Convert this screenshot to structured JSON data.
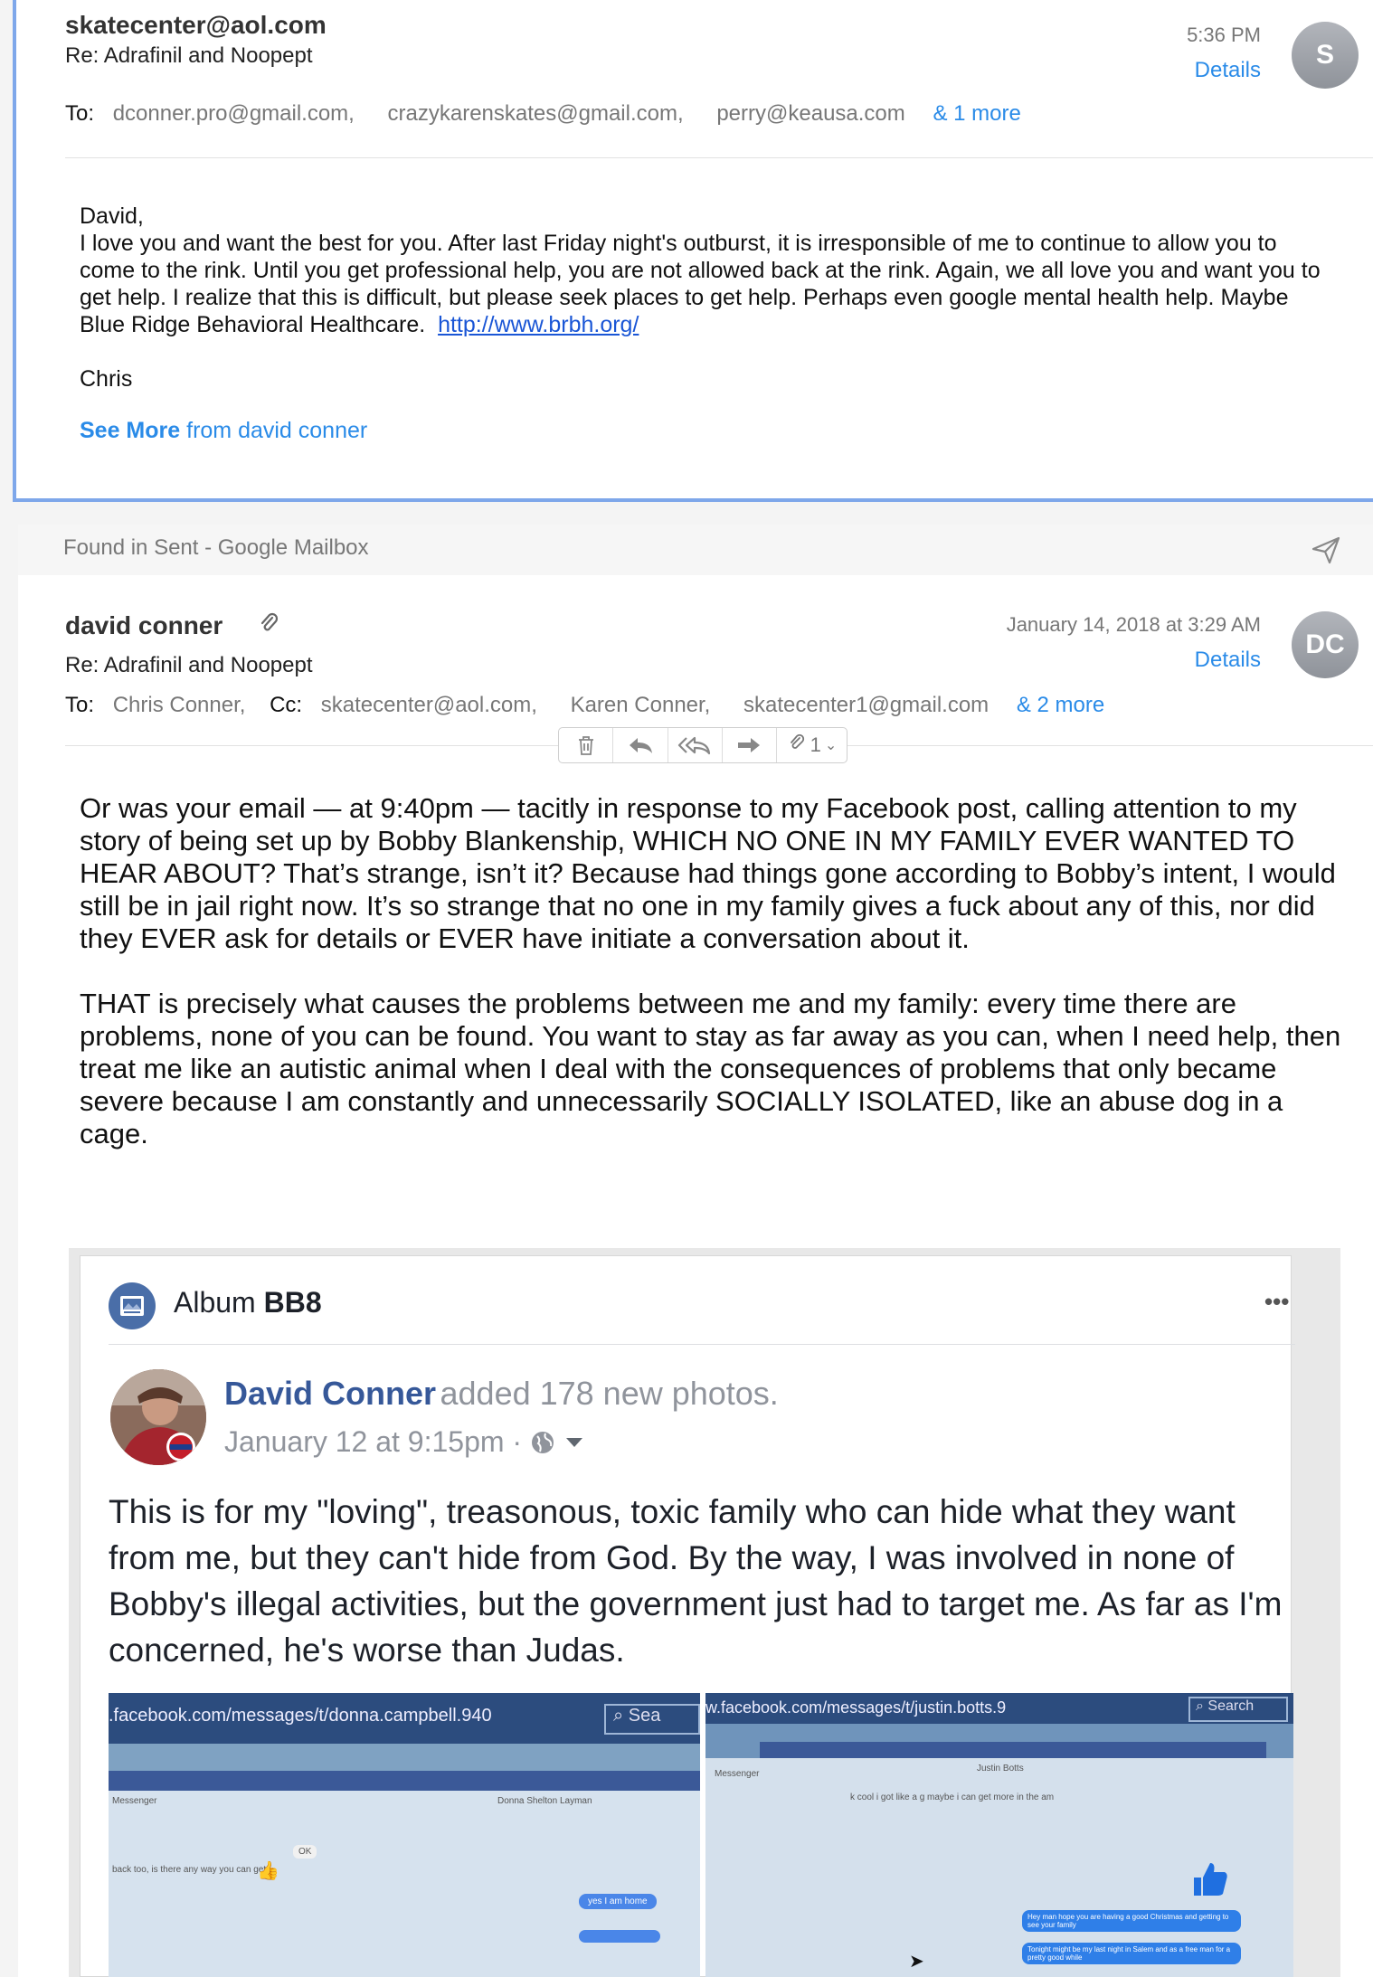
{
  "email1": {
    "sender": "skatecenter@aol.com",
    "subject": "Re: Adrafinil and Noopept",
    "to_label": "To:",
    "recipients": [
      "dconner.pro@gmail.com,",
      "crazykarenskates@gmail.com,",
      "perry@keausa.com"
    ],
    "more": "& 1 more",
    "time": "5:36 PM",
    "details": "Details",
    "avatar": "S",
    "greeting": "David,",
    "body_text": "I love you and want the best for you.  After last Friday night's outburst, it is irresponsible of me to continue to allow you to come to the rink.  Until you get professional help, you are not allowed back at the rink.  Again, we all love you and want you to get help.  I realize that this is difficult, but please seek places to get help.  Perhaps even google mental health help.  Maybe Blue Ridge Behavioral Healthcare.",
    "link": "http://www.brbh.org/",
    "signature": "Chris",
    "see_more_bold": "See More",
    "see_more_rest": "from david conner"
  },
  "found_bar": {
    "label": "Found in Sent - Google Mailbox",
    "icon": "send-icon"
  },
  "email2": {
    "sender": "david conner",
    "attachment_icon": "paperclip-icon",
    "subject": "Re: Adrafinil and Noopept",
    "to_label": "To:",
    "to": "Chris Conner,",
    "cc_label": "Cc:",
    "cc": [
      "skatecenter@aol.com,",
      "Karen Conner,",
      "skatecenter1@gmail.com"
    ],
    "more": "& 2 more",
    "time": "January 14, 2018 at 3:29 AM",
    "details": "Details",
    "avatar": "DC",
    "toolbar": {
      "icons": [
        "trash-icon",
        "reply-icon",
        "reply-all-icon",
        "forward-icon",
        "attachment-icon"
      ],
      "attachment_count": "1"
    },
    "para1": "Or was your email — at 9:40pm — tacitly in response to my Facebook post, calling attention to my story of being set up by Bobby Blankenship, WHICH NO ONE IN MY FAMILY EVER WANTED TO HEAR ABOUT? That’s strange, isn’t it? Because had things gone according to Bobby’s intent, I would still be in jail right now. It’s so strange that no one in my family gives a fuck about any of this, nor did they EVER ask for details or EVER have initiate a conversation about it.",
    "para2": "THAT is precisely what causes the problems between me and my family: every time there are problems, none of you can be found. You want to stay as far away as you can, when I need help, then treat me like an autistic animal when I deal with the consequences of problems that only became severe because I am constantly and unnecessarily SOCIALLY ISOLATED, like an abuse dog in a cage."
  },
  "facebook": {
    "album_prefix": "Album",
    "album_name": "BB8",
    "more_icon": "•••",
    "name": "David Conner",
    "added": "added 178 new photos.",
    "date": "January 12 at 9:15pm ·",
    "post": "This is for my \"loving\", treasonous, toxic family who can hide what they want from me, but they can't hide from God. By the way, I was involved in none of Bobby's illegal activities, but the government just had to target me. As far as I'm concerned, he's worse than Judas.",
    "photo1": {
      "url": ".facebook.com/messages/t/donna.campbell.940",
      "search": "Sea",
      "header": "Messenger",
      "contact": "Donna Shelton Layman",
      "msg": "back too, is there any way you can get i",
      "reply1": "OK",
      "reply2": "yes I am home"
    },
    "photo2": {
      "url": "w.facebook.com/messages/t/justin.botts.9",
      "search": "Search",
      "header": "Messenger",
      "contact": "Justin Botts",
      "msg": "k cool i got like a g maybe i can get more in the am",
      "bubble1": "Hey man hope you are having a good Christmas and getting to see your family",
      "bubble2": "Tonight might be my last night in Salem and as a free man for a pretty good while"
    }
  }
}
